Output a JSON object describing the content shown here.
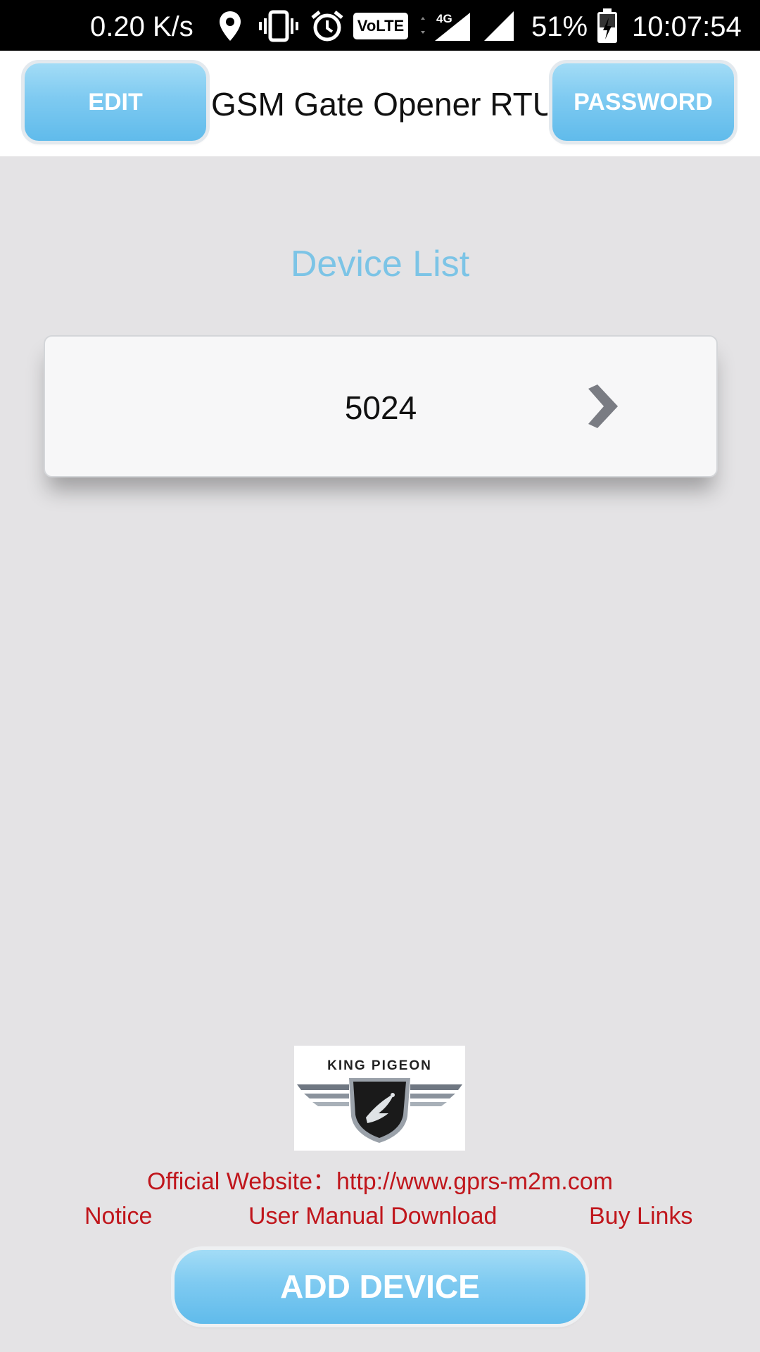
{
  "status_bar": {
    "net_speed": "0.20 K/s",
    "volte_label": "VoLTE",
    "network_type": "4G",
    "battery": "51%",
    "time": "10:07:54",
    "icons": [
      "location-icon",
      "vibrate-icon",
      "alarm-icon",
      "volte-icon",
      "signal-4g-icon",
      "signal-icon",
      "battery-charging-icon"
    ]
  },
  "header": {
    "edit_label": "EDIT",
    "title": "GSM Gate Opener RTU",
    "password_label": "PASSWORD"
  },
  "main": {
    "list_title": "Device List",
    "devices": [
      {
        "name": "5024",
        "icon": "chevron-right-icon"
      }
    ]
  },
  "footer": {
    "logo_text": "KING PIGEON",
    "website_line": "Official Website：http://www.gprs-m2m.com",
    "links": {
      "notice": "Notice",
      "manual": "User Manual Download",
      "buy": "Buy Links"
    },
    "add_device_label": "ADD DEVICE"
  },
  "colors": {
    "accent_blue": "#7ecaf1",
    "title_blue": "#7cc4e6",
    "link_red": "#c0161c",
    "background": "#e4e3e5"
  }
}
